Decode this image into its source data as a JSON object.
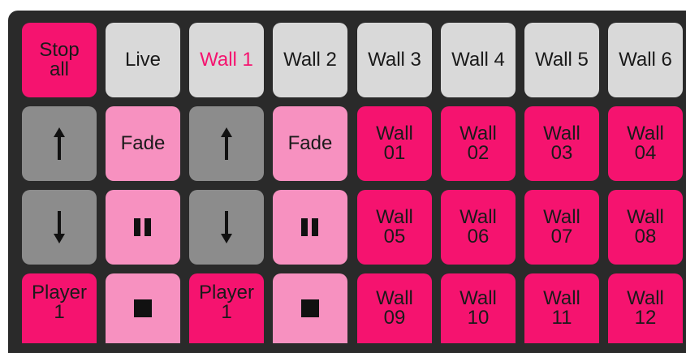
{
  "colors": {
    "panel": "#2a2a2a",
    "hot_pink": "#f5136f",
    "light_pink": "#f791c0",
    "light_gray": "#d9d9d9",
    "mid_gray": "#8c8c8c"
  },
  "row1": {
    "stop_all": [
      "Stop",
      "all"
    ],
    "live": "Live",
    "walls": [
      "Wall 1",
      "Wall 2",
      "Wall 3",
      "Wall 4",
      "Wall 5",
      "Wall 6"
    ],
    "active_wall": "Wall 1"
  },
  "controls": {
    "fade_label": "Fade",
    "up_icon": "arrow-up-icon",
    "down_icon": "arrow-down-icon",
    "pause_icon": "pause-icon",
    "stop_icon": "stop-icon",
    "players": [
      [
        "Player",
        "1"
      ],
      [
        "Player",
        "1"
      ]
    ]
  },
  "wall_grid": [
    [
      "Wall",
      "01"
    ],
    [
      "Wall",
      "02"
    ],
    [
      "Wall",
      "03"
    ],
    [
      "Wall",
      "04"
    ],
    [
      "Wall",
      "05"
    ],
    [
      "Wall",
      "06"
    ],
    [
      "Wall",
      "07"
    ],
    [
      "Wall",
      "08"
    ],
    [
      "Wall",
      "09"
    ],
    [
      "Wall",
      "10"
    ],
    [
      "Wall",
      "11"
    ],
    [
      "Wall",
      "12"
    ]
  ]
}
